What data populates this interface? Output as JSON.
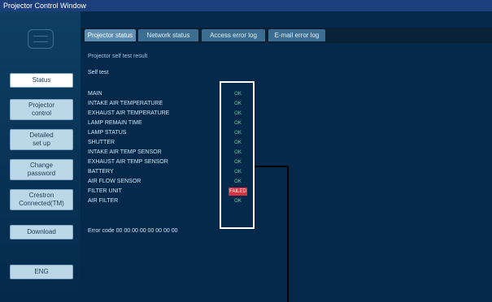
{
  "window": {
    "title": "Projector Control Window"
  },
  "sidebar": {
    "items": [
      {
        "label": "Status"
      },
      {
        "label": "Projector\ncontrol"
      },
      {
        "label": "Detailed\nset up"
      },
      {
        "label": "Change\npassword"
      },
      {
        "label": "Crestron\nConnected(TM)"
      },
      {
        "label": "Download"
      },
      {
        "label": "ENG"
      }
    ]
  },
  "tabs": [
    {
      "label": "Projector status"
    },
    {
      "label": "Network status"
    },
    {
      "label": "Access error log"
    },
    {
      "label": "E-mail error log"
    }
  ],
  "content": {
    "subheading": "Projector self test result",
    "group_heading": "Self test",
    "rows": [
      {
        "label": "MAIN",
        "status": "OK"
      },
      {
        "label": "INTAKE AIR TEMPERATURE",
        "status": "OK"
      },
      {
        "label": "EXHAUST AIR TEMPERATURE",
        "status": "OK"
      },
      {
        "label": "LAMP REMAIN TIME",
        "status": "OK"
      },
      {
        "label": "LAMP STATUS",
        "status": "OK"
      },
      {
        "label": "SHUTTER",
        "status": "OK"
      },
      {
        "label": "INTAKE AIR TEMP SENSOR",
        "status": "OK"
      },
      {
        "label": "EXHAUST AIR TEMP SENSOR",
        "status": "OK"
      },
      {
        "label": "BATTERY",
        "status": "OK"
      },
      {
        "label": "AIR FLOW SENSOR",
        "status": "OK"
      },
      {
        "label": "FILTER UNIT",
        "status": "FAILED"
      },
      {
        "label": "AIR FILTER",
        "status": "OK"
      }
    ],
    "footer": "Error code 00 00 00 00 00 00 00 00"
  },
  "colors": {
    "ok": "#58d68d",
    "error": "#d9333f",
    "background": "#05294a"
  }
}
